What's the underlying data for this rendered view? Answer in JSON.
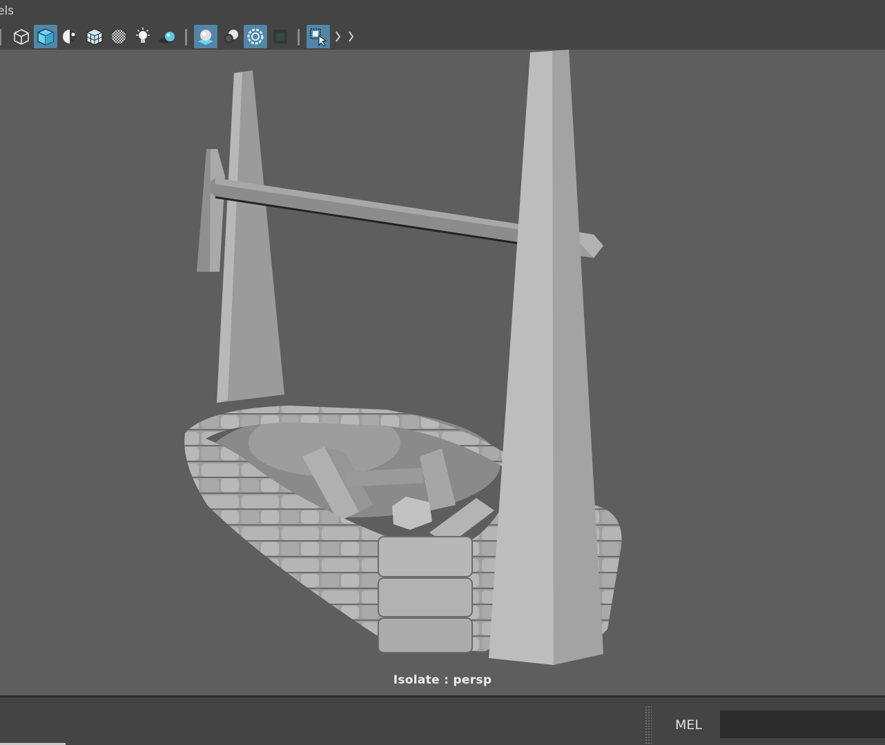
{
  "menu": {
    "panels_label": "els"
  },
  "toolbar": {
    "icons": [
      "wireframe-shade-icon",
      "smooth-shade-all-icon",
      "use-default-material-icon",
      "wireframe-on-shaded-icon",
      "xray-icon",
      "lighting-icon",
      "shadows-icon",
      "screen-space-ambient-occlusion-icon",
      "motion-blur-icon",
      "multisample-anti-aliasing-icon",
      "depth-of-field-icon",
      "isolate-select-icon"
    ]
  },
  "viewport": {
    "label": "Isolate : persp"
  },
  "command_line": {
    "language_label": "MEL",
    "value": ""
  },
  "colors": {
    "accent": "#5285a6",
    "panel": "#444444",
    "viewport": "#5e5e5e"
  }
}
